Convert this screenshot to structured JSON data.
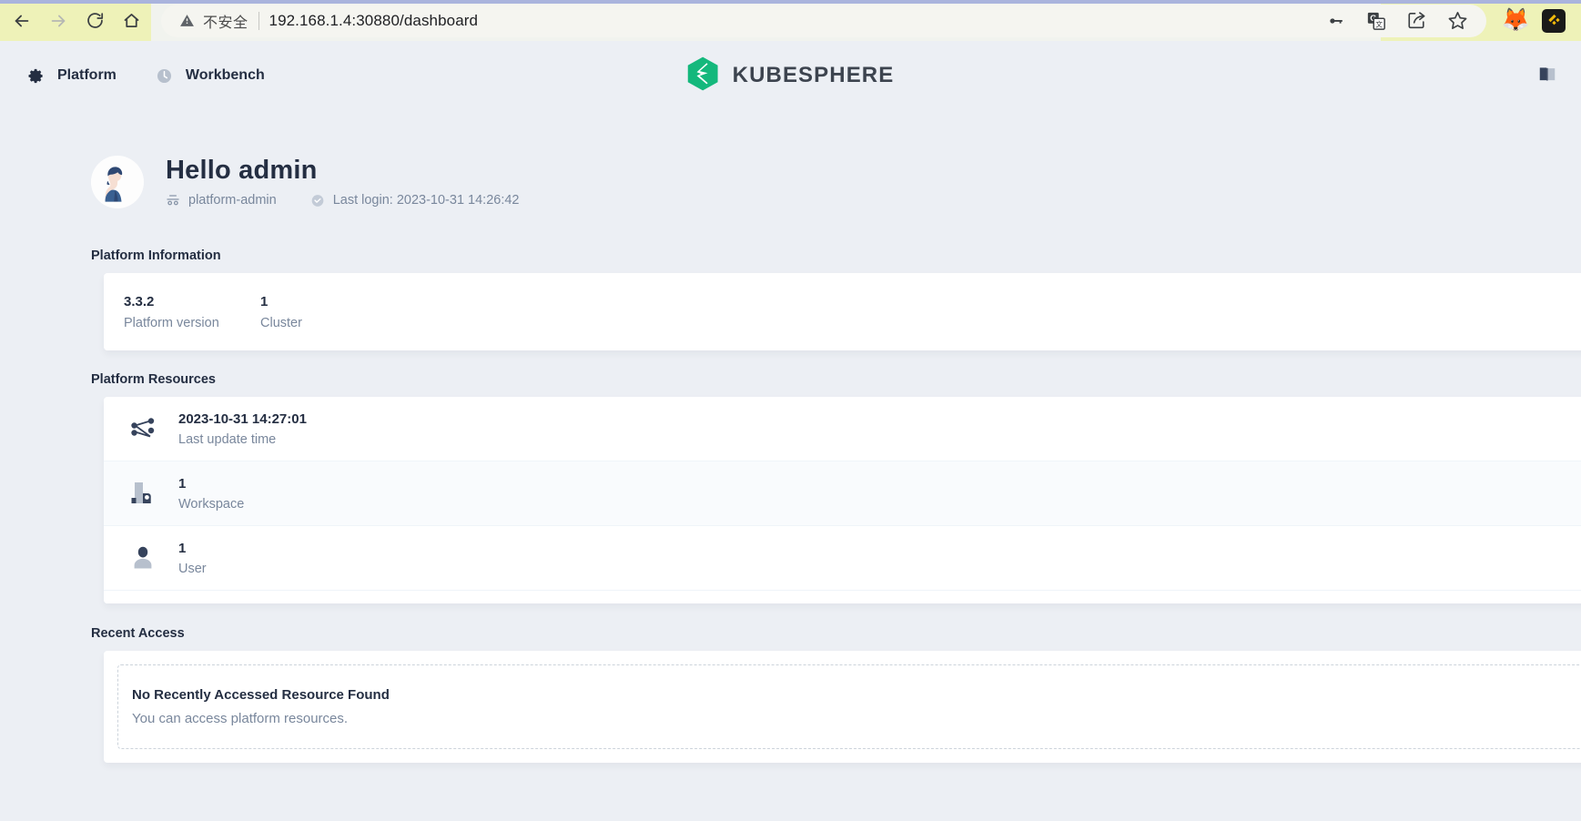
{
  "browser": {
    "nav": {
      "back_label": "Back",
      "forward_label": "Forward",
      "reload_label": "Reload",
      "home_label": "Home"
    },
    "omnibox": {
      "security_label": "不安全",
      "url": "192.168.1.4:30880/dashboard",
      "actions": [
        "password-key-icon",
        "translate-icon",
        "share-icon",
        "bookmark-star-icon"
      ]
    },
    "extensions": [
      "metamask-fox-icon",
      "binance-bnb-icon"
    ],
    "tab_strip_color": "#eef2b8",
    "toolbar_color": "#f1f3ee"
  },
  "header": {
    "nav_items": [
      {
        "icon": "gear-icon",
        "label": "Platform"
      },
      {
        "icon": "clock-icon",
        "label": "Workbench"
      }
    ],
    "logo": {
      "icon": "kubesphere-hexagon-icon",
      "text": "KUBESPHERE",
      "color": "#14b87c"
    },
    "right_icon": "documentation-book-icon"
  },
  "greeting": {
    "avatar": "user-avatar",
    "title": "Hello admin",
    "role_icon": "role-glasses-icon",
    "role": "platform-admin",
    "last_login_icon": "clock-check-icon",
    "last_login": "Last login: 2023-10-31 14:26:42"
  },
  "platform_information": {
    "section_title": "Platform Information",
    "items": [
      {
        "value": "3.3.2",
        "label": "Platform version"
      },
      {
        "value": "1",
        "label": "Cluster"
      }
    ]
  },
  "platform_resources": {
    "section_title": "Platform Resources",
    "items": [
      {
        "icon": "share-nodes-icon",
        "value": "2023-10-31 14:27:01",
        "label": "Last update time"
      },
      {
        "icon": "workspace-building-icon",
        "value": "1",
        "label": "Workspace"
      },
      {
        "icon": "user-person-icon",
        "value": "1",
        "label": "User"
      }
    ]
  },
  "recent_access": {
    "section_title": "Recent Access",
    "empty_title": "No Recently Accessed Resource Found",
    "empty_desc": "You can access platform resources."
  },
  "theme": {
    "page_bg": "#eceff4",
    "card_bg": "#ffffff",
    "text_primary": "#242e42",
    "text_secondary": "#79879c",
    "brand_green": "#14b87c"
  }
}
